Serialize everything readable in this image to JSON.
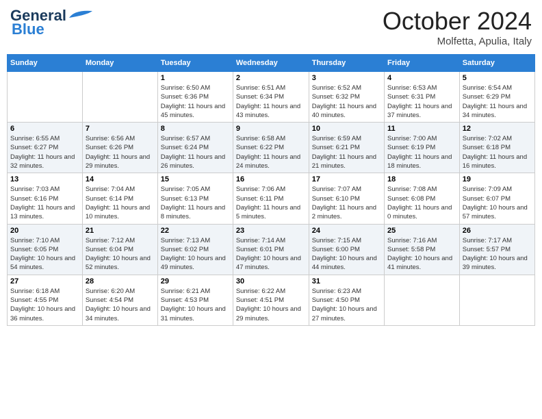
{
  "header": {
    "logo_general": "General",
    "logo_blue": "Blue",
    "month": "October 2024",
    "location": "Molfetta, Apulia, Italy"
  },
  "weekdays": [
    "Sunday",
    "Monday",
    "Tuesday",
    "Wednesday",
    "Thursday",
    "Friday",
    "Saturday"
  ],
  "weeks": [
    [
      {
        "day": "",
        "detail": ""
      },
      {
        "day": "",
        "detail": ""
      },
      {
        "day": "1",
        "detail": "Sunrise: 6:50 AM\nSunset: 6:36 PM\nDaylight: 11 hours and 45 minutes."
      },
      {
        "day": "2",
        "detail": "Sunrise: 6:51 AM\nSunset: 6:34 PM\nDaylight: 11 hours and 43 minutes."
      },
      {
        "day": "3",
        "detail": "Sunrise: 6:52 AM\nSunset: 6:32 PM\nDaylight: 11 hours and 40 minutes."
      },
      {
        "day": "4",
        "detail": "Sunrise: 6:53 AM\nSunset: 6:31 PM\nDaylight: 11 hours and 37 minutes."
      },
      {
        "day": "5",
        "detail": "Sunrise: 6:54 AM\nSunset: 6:29 PM\nDaylight: 11 hours and 34 minutes."
      }
    ],
    [
      {
        "day": "6",
        "detail": "Sunrise: 6:55 AM\nSunset: 6:27 PM\nDaylight: 11 hours and 32 minutes."
      },
      {
        "day": "7",
        "detail": "Sunrise: 6:56 AM\nSunset: 6:26 PM\nDaylight: 11 hours and 29 minutes."
      },
      {
        "day": "8",
        "detail": "Sunrise: 6:57 AM\nSunset: 6:24 PM\nDaylight: 11 hours and 26 minutes."
      },
      {
        "day": "9",
        "detail": "Sunrise: 6:58 AM\nSunset: 6:22 PM\nDaylight: 11 hours and 24 minutes."
      },
      {
        "day": "10",
        "detail": "Sunrise: 6:59 AM\nSunset: 6:21 PM\nDaylight: 11 hours and 21 minutes."
      },
      {
        "day": "11",
        "detail": "Sunrise: 7:00 AM\nSunset: 6:19 PM\nDaylight: 11 hours and 18 minutes."
      },
      {
        "day": "12",
        "detail": "Sunrise: 7:02 AM\nSunset: 6:18 PM\nDaylight: 11 hours and 16 minutes."
      }
    ],
    [
      {
        "day": "13",
        "detail": "Sunrise: 7:03 AM\nSunset: 6:16 PM\nDaylight: 11 hours and 13 minutes."
      },
      {
        "day": "14",
        "detail": "Sunrise: 7:04 AM\nSunset: 6:14 PM\nDaylight: 11 hours and 10 minutes."
      },
      {
        "day": "15",
        "detail": "Sunrise: 7:05 AM\nSunset: 6:13 PM\nDaylight: 11 hours and 8 minutes."
      },
      {
        "day": "16",
        "detail": "Sunrise: 7:06 AM\nSunset: 6:11 PM\nDaylight: 11 hours and 5 minutes."
      },
      {
        "day": "17",
        "detail": "Sunrise: 7:07 AM\nSunset: 6:10 PM\nDaylight: 11 hours and 2 minutes."
      },
      {
        "day": "18",
        "detail": "Sunrise: 7:08 AM\nSunset: 6:08 PM\nDaylight: 11 hours and 0 minutes."
      },
      {
        "day": "19",
        "detail": "Sunrise: 7:09 AM\nSunset: 6:07 PM\nDaylight: 10 hours and 57 minutes."
      }
    ],
    [
      {
        "day": "20",
        "detail": "Sunrise: 7:10 AM\nSunset: 6:05 PM\nDaylight: 10 hours and 54 minutes."
      },
      {
        "day": "21",
        "detail": "Sunrise: 7:12 AM\nSunset: 6:04 PM\nDaylight: 10 hours and 52 minutes."
      },
      {
        "day": "22",
        "detail": "Sunrise: 7:13 AM\nSunset: 6:02 PM\nDaylight: 10 hours and 49 minutes."
      },
      {
        "day": "23",
        "detail": "Sunrise: 7:14 AM\nSunset: 6:01 PM\nDaylight: 10 hours and 47 minutes."
      },
      {
        "day": "24",
        "detail": "Sunrise: 7:15 AM\nSunset: 6:00 PM\nDaylight: 10 hours and 44 minutes."
      },
      {
        "day": "25",
        "detail": "Sunrise: 7:16 AM\nSunset: 5:58 PM\nDaylight: 10 hours and 41 minutes."
      },
      {
        "day": "26",
        "detail": "Sunrise: 7:17 AM\nSunset: 5:57 PM\nDaylight: 10 hours and 39 minutes."
      }
    ],
    [
      {
        "day": "27",
        "detail": "Sunrise: 6:18 AM\nSunset: 4:55 PM\nDaylight: 10 hours and 36 minutes."
      },
      {
        "day": "28",
        "detail": "Sunrise: 6:20 AM\nSunset: 4:54 PM\nDaylight: 10 hours and 34 minutes."
      },
      {
        "day": "29",
        "detail": "Sunrise: 6:21 AM\nSunset: 4:53 PM\nDaylight: 10 hours and 31 minutes."
      },
      {
        "day": "30",
        "detail": "Sunrise: 6:22 AM\nSunset: 4:51 PM\nDaylight: 10 hours and 29 minutes."
      },
      {
        "day": "31",
        "detail": "Sunrise: 6:23 AM\nSunset: 4:50 PM\nDaylight: 10 hours and 27 minutes."
      },
      {
        "day": "",
        "detail": ""
      },
      {
        "day": "",
        "detail": ""
      }
    ]
  ]
}
